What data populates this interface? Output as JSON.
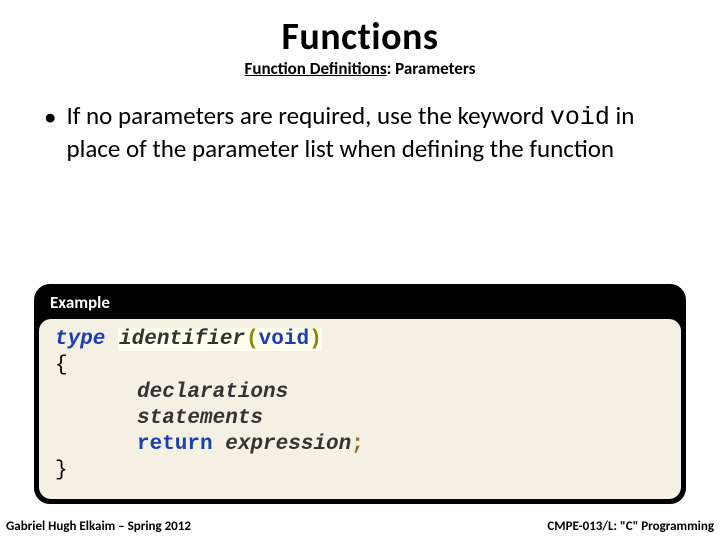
{
  "title": "Functions",
  "subtitle_underlined": "Function Definitions",
  "subtitle_rest": ": Parameters",
  "bullet_pre": "If no parameters are required, use the keyword ",
  "bullet_code": "void",
  "bullet_post": " in place of the parameter list when defining the function",
  "example_label": "Example",
  "code": {
    "type_kw": "type",
    "identifier": "identifier",
    "lparen": "(",
    "void": "void",
    "rparen": ")",
    "lbrace": "{",
    "declarations": "declarations",
    "statements": "statements",
    "return_kw": "return",
    "expression": "expression",
    "semicolon": ";",
    "rbrace": "}"
  },
  "footer_left": "Gabriel Hugh Elkaim – Spring 2012",
  "footer_right": "CMPE-013/L: \"C\" Programming"
}
